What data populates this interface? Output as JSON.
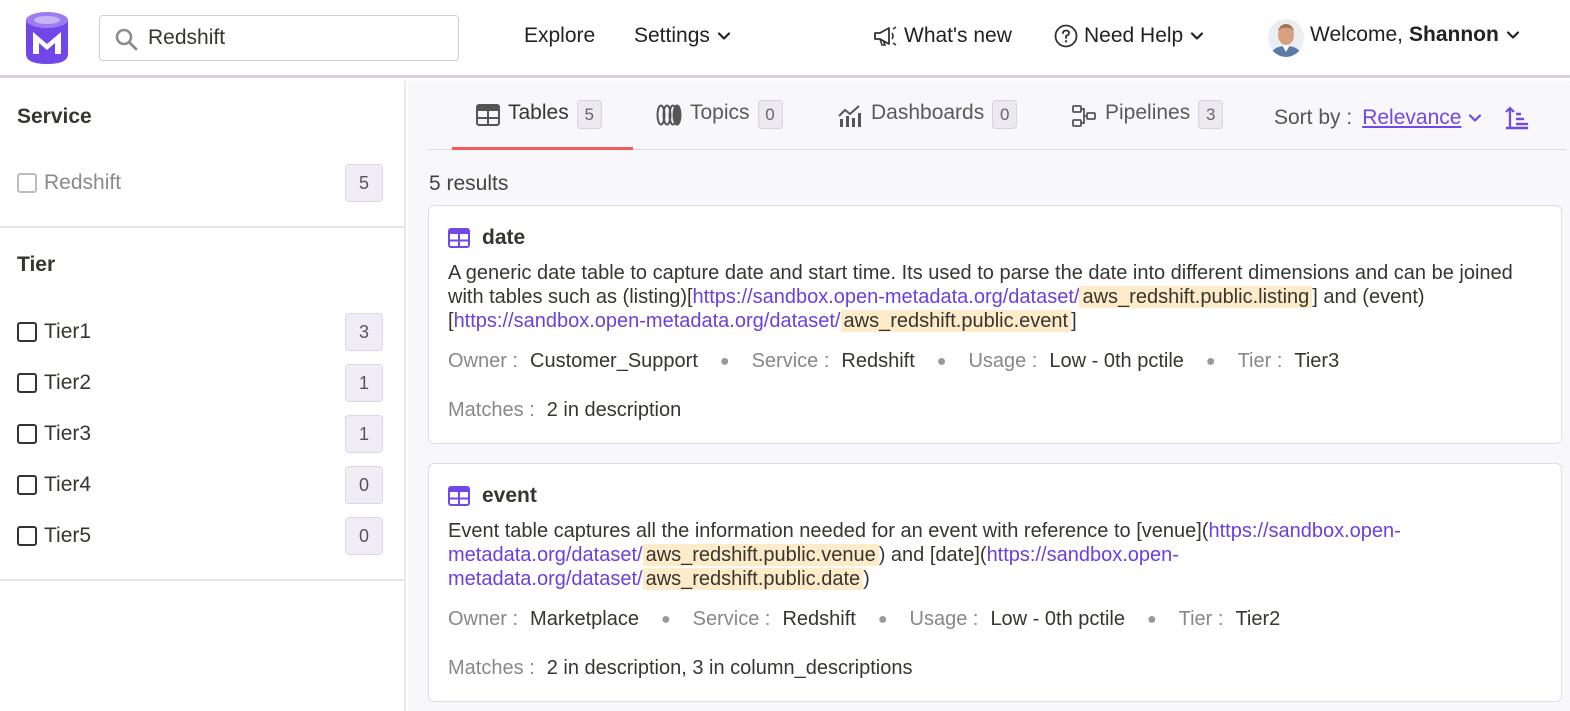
{
  "header": {
    "search_value": "Redshift",
    "nav": {
      "explore": "Explore",
      "settings": "Settings",
      "whats_new": "What's new",
      "need_help": "Need Help"
    },
    "welcome_prefix": "Welcome,",
    "user_name": "Shannon"
  },
  "sidebar": {
    "service_title": "Service",
    "service_items": [
      {
        "label": "Redshift",
        "count": "5"
      }
    ],
    "tier_title": "Tier",
    "tier_items": [
      {
        "label": "Tier1",
        "count": "3"
      },
      {
        "label": "Tier2",
        "count": "1"
      },
      {
        "label": "Tier3",
        "count": "1"
      },
      {
        "label": "Tier4",
        "count": "0"
      },
      {
        "label": "Tier5",
        "count": "0"
      }
    ]
  },
  "main": {
    "tabs": [
      {
        "label": "Tables",
        "count": "5"
      },
      {
        "label": "Topics",
        "count": "0"
      },
      {
        "label": "Dashboards",
        "count": "0"
      },
      {
        "label": "Pipelines",
        "count": "3"
      }
    ],
    "sort_label": "Sort by :",
    "sort_value": "Relevance",
    "results_count": "5 results",
    "results": [
      {
        "name": "date",
        "desc": {
          "t1": "A generic date table to capture date and start time. Its used to parse the date into different dimensions and can be joined with tables such as (listing)[",
          "link1": "https://sandbox.open-metadata.org/dataset/",
          "hl1": "aws_redshift.public.listing",
          "t2": "] and (event)[",
          "link2": "https://sandbox.open-metadata.org/dataset/",
          "hl2": "aws_redshift.public.event",
          "t3": "]"
        },
        "owner_label": "Owner :",
        "owner": "Customer_Support",
        "service_label": "Service :",
        "service": "Redshift",
        "usage_label": "Usage :",
        "usage": "Low - 0th pctile",
        "tier_label": "Tier :",
        "tier": "Tier3",
        "matches_label": "Matches :",
        "matches": "2 in description"
      },
      {
        "name": "event",
        "desc": {
          "t1": "Event table captures all the information needed for an event with reference to [venue](",
          "link1": "https://sandbox.open-metadata.org/dataset/",
          "hl1": "aws_redshift.public.venue",
          "t2": ") and [date](",
          "link2": "https://sandbox.open-metadata.org/dataset/",
          "hl2": "aws_redshift.public.date",
          "t3": ")"
        },
        "owner_label": "Owner :",
        "owner": "Marketplace",
        "service_label": "Service :",
        "service": "Redshift",
        "usage_label": "Usage :",
        "usage": "Low - 0th pctile",
        "tier_label": "Tier :",
        "tier": "Tier2",
        "matches_label": "Matches :",
        "matches": "2 in description,  3 in column_descriptions"
      }
    ]
  },
  "colors": {
    "brand": "#7147e8",
    "active_tab_underline": "#f15b5b",
    "highlight": "#fdebc9"
  },
  "icons": [
    "logo",
    "search-icon",
    "chevron-down-icon",
    "megaphone-icon",
    "help-circle-icon",
    "avatar",
    "table-icon",
    "topics-icon",
    "dashboard-icon",
    "pipeline-icon",
    "sort-ascending-icon"
  ]
}
